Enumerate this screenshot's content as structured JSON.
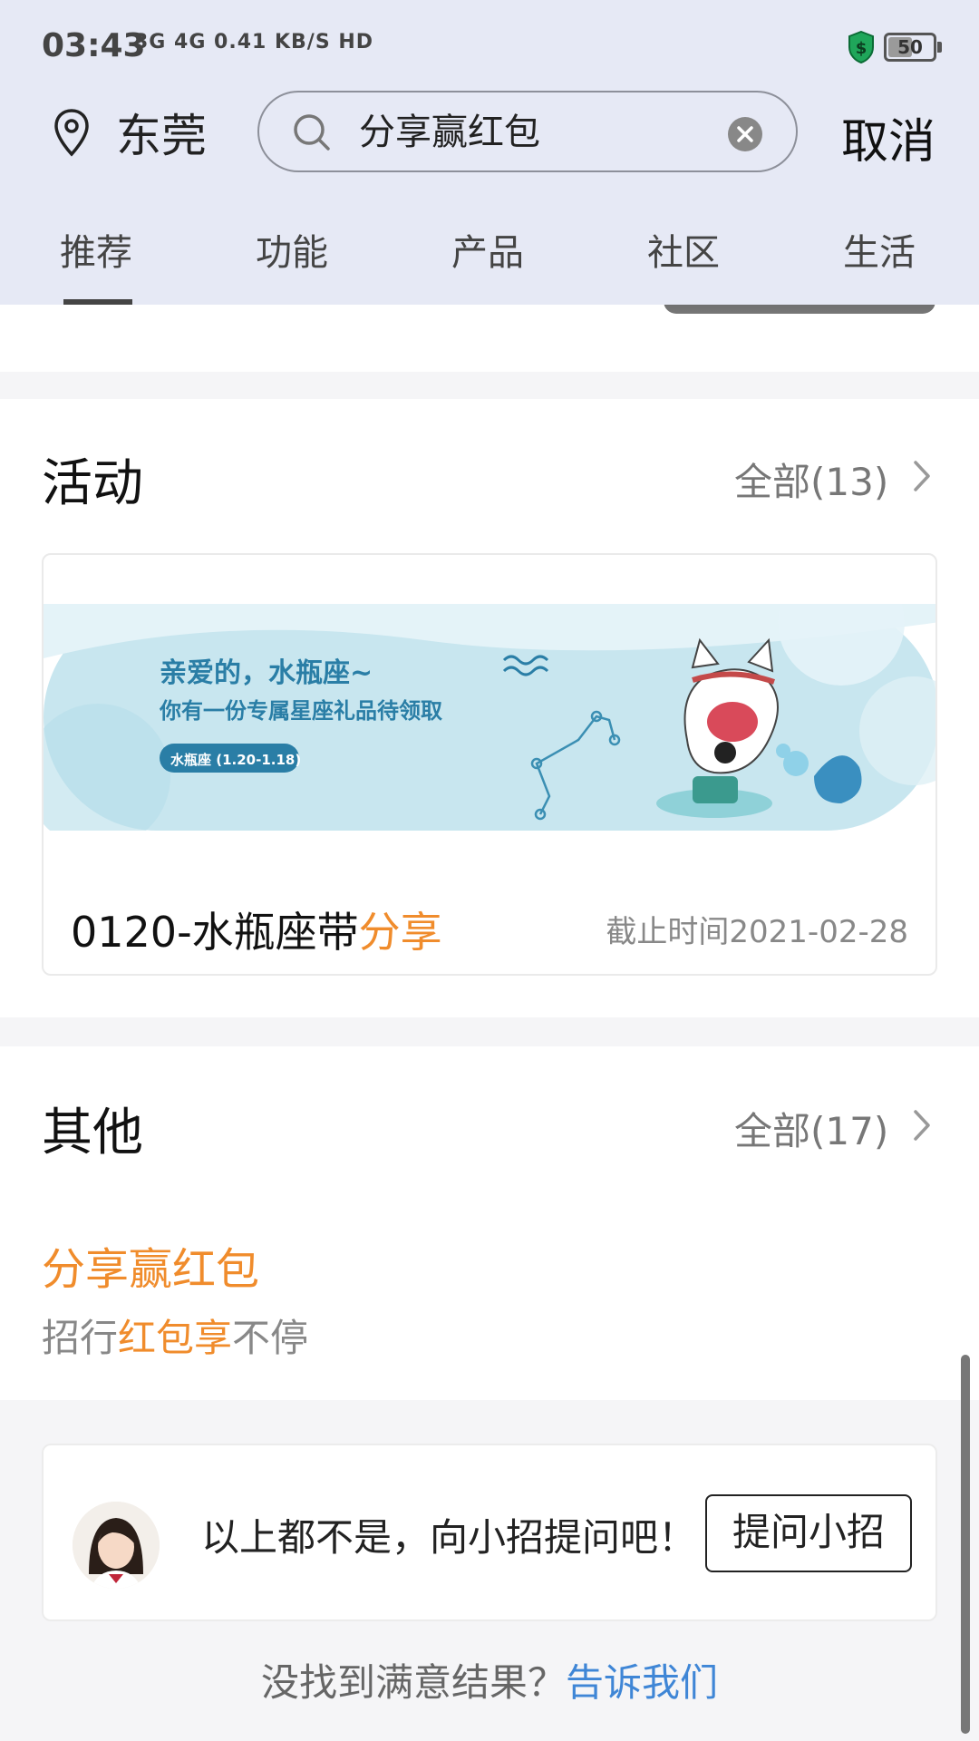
{
  "status": {
    "time": "03:43",
    "network": "3G 4G 0.41 KB/S HD",
    "battery": "50",
    "battery_level": 0.5
  },
  "header": {
    "location": "东莞",
    "search_value": "分享赢红包",
    "cancel_label": "取消"
  },
  "tabs": [
    {
      "label": "推荐",
      "active": true
    },
    {
      "label": "功能"
    },
    {
      "label": "产品"
    },
    {
      "label": "社区"
    },
    {
      "label": "生活"
    }
  ],
  "activity": {
    "title": "活动",
    "more_label": "全部(13)",
    "banner": {
      "line1": "亲爱的，水瓶座~",
      "line2": "你有一份专属星座礼品待领取",
      "badge": "水瓶座 (1.20-1.18)"
    },
    "item": {
      "name_prefix": "0120-水瓶座带",
      "name_highlight": "分享",
      "deadline": "截止时间2021-02-28"
    }
  },
  "other": {
    "title": "其他",
    "more_label": "全部(17)",
    "item_title": "分享赢红包",
    "item_sub_prefix": "招行",
    "item_sub_highlight": "红包享",
    "item_sub_suffix": "不停"
  },
  "ask": {
    "text": "以上都不是，向小招提问吧！",
    "button_label": "提问小招"
  },
  "footer": {
    "prefix": "没找到满意结果？",
    "link": "告诉我们"
  },
  "colors": {
    "header_bg": "#e6e9f5",
    "accent_orange": "#f08c2c",
    "link_blue": "#3f86d6"
  }
}
